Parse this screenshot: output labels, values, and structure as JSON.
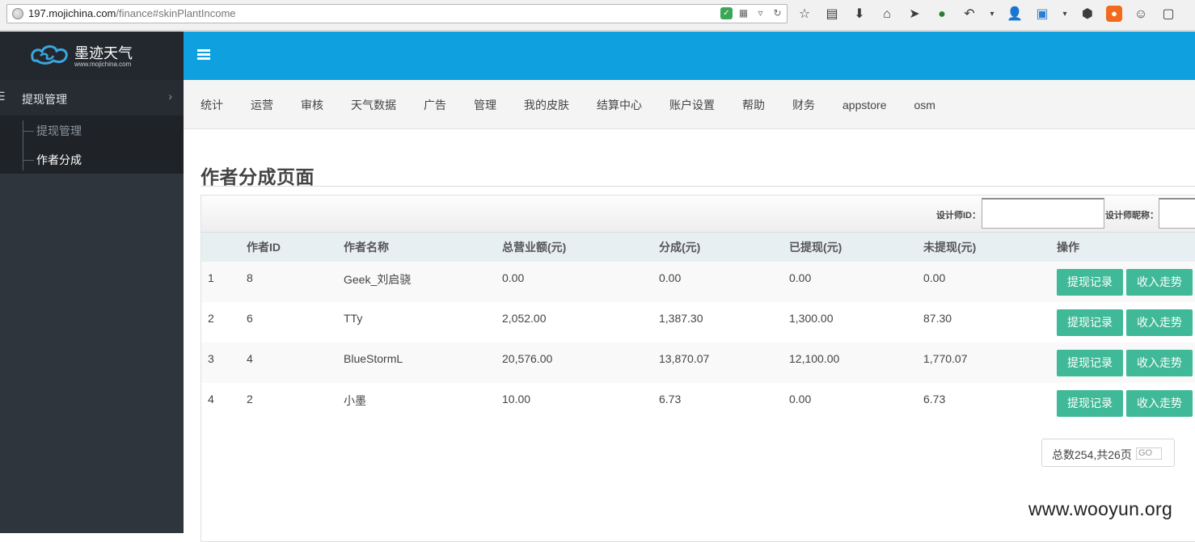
{
  "browser": {
    "url_host": "197.mojichina.com",
    "url_path": "/finance#skinPlantIncome"
  },
  "sidebar": {
    "logo_name": "墨迹天气",
    "logo_url": "www.mojichina.com",
    "group_label": "提现管理",
    "items": [
      {
        "label": "提现管理"
      },
      {
        "label": "作者分成"
      }
    ]
  },
  "topnav": {
    "items": [
      "统计",
      "运营",
      "审核",
      "天气数据",
      "广告",
      "管理",
      "我的皮肤",
      "结算中心",
      "账户设置",
      "帮助",
      "财务",
      "appstore",
      "osm"
    ]
  },
  "page": {
    "title": "作者分成页面",
    "filter": {
      "designer_id_label": "设计师ID：",
      "designer_nick_label": "设计师昵称："
    }
  },
  "table": {
    "headers": [
      "",
      "作者ID",
      "作者名称",
      "总营业额(元)",
      "分成(元)",
      "已提现(元)",
      "未提现(元)",
      "操作"
    ],
    "rows": [
      {
        "no": "1",
        "id": "8",
        "name": "Geek_刘启骁",
        "total": "0.00",
        "share": "0.00",
        "withdrawn": "0.00",
        "pending": "0.00"
      },
      {
        "no": "2",
        "id": "6",
        "name": "TTy",
        "total": "2,052.00",
        "share": "1,387.30",
        "withdrawn": "1,300.00",
        "pending": "87.30"
      },
      {
        "no": "3",
        "id": "4",
        "name": "BlueStormL",
        "total": "20,576.00",
        "share": "13,870.07",
        "withdrawn": "12,100.00",
        "pending": "1,770.07"
      },
      {
        "no": "4",
        "id": "2",
        "name": "小墨",
        "total": "10.00",
        "share": "6.73",
        "withdrawn": "0.00",
        "pending": "6.73"
      }
    ],
    "btn_withdraw_record": "提现记录",
    "btn_income_trend": "收入走势"
  },
  "pager": {
    "text": "总数254,共26页",
    "go": "GO"
  },
  "watermark": "www.wooyun.org"
}
